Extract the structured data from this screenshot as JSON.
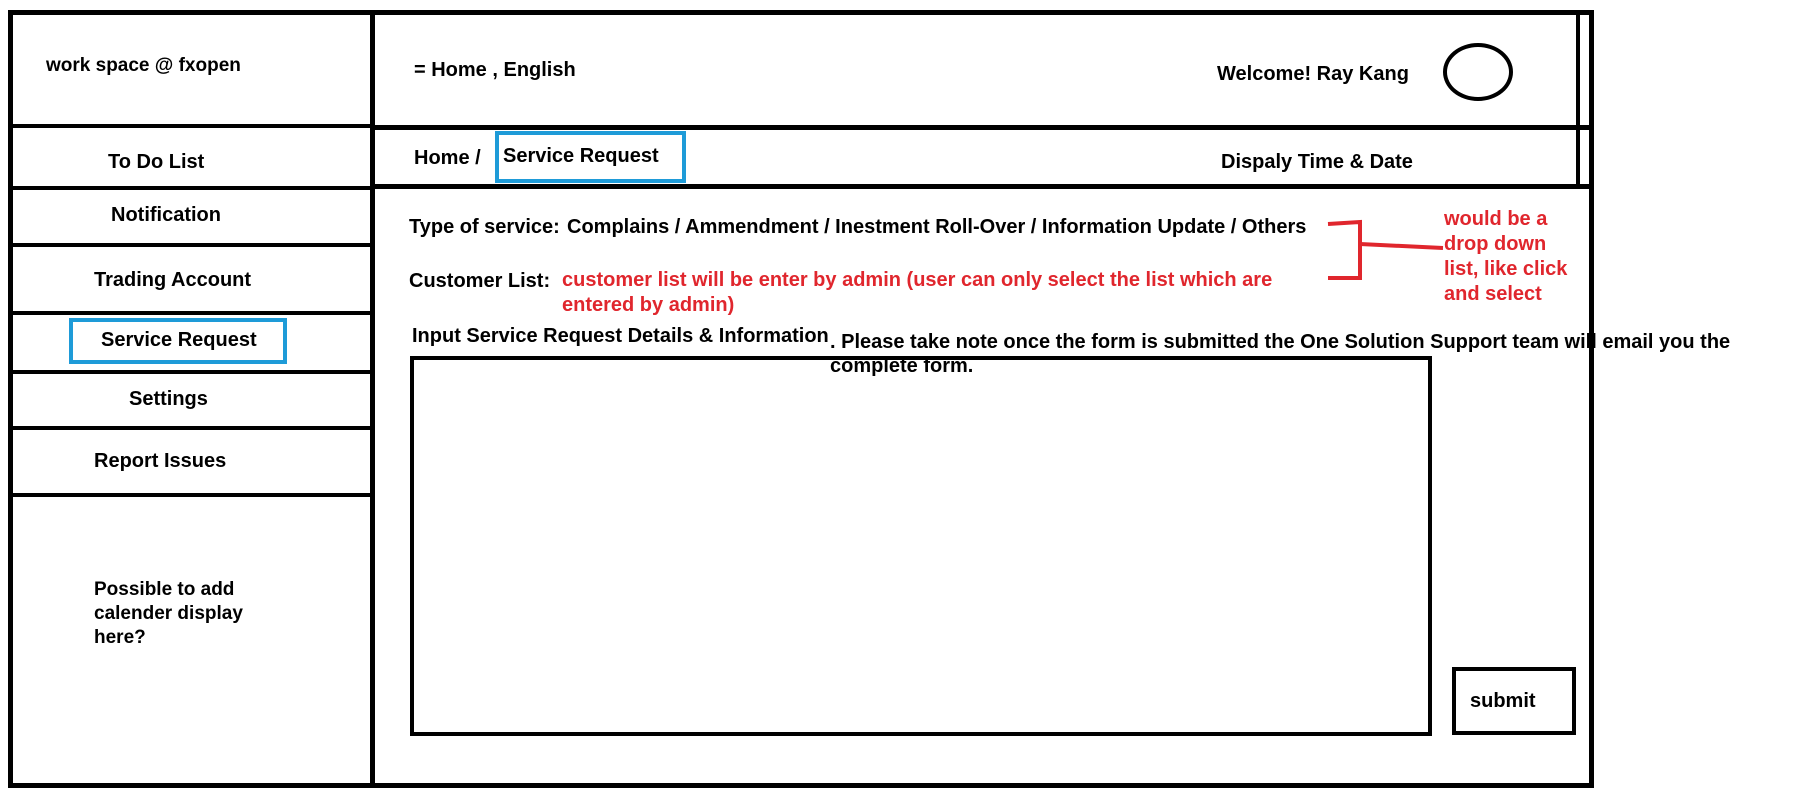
{
  "header": {
    "brand": "work space @ fxopen",
    "nav": "= Home , English",
    "welcome": "Welcome! Ray Kang"
  },
  "sidebar": {
    "items": [
      {
        "label": "To Do List"
      },
      {
        "label": "Notification"
      },
      {
        "label": "Trading Account"
      },
      {
        "label": "Service Request"
      },
      {
        "label": "Settings"
      },
      {
        "label": "Report Issues"
      }
    ],
    "calendar_note": "Possible to add calender display here?"
  },
  "breadcrumb": {
    "home": "Home /",
    "current": "Service Request",
    "datetime": "Dispaly Time & Date"
  },
  "form": {
    "service_type_label": "Type of service:",
    "service_type_options": "Complains / Ammendment / Inestment Roll-Over / Information Update / Others",
    "customer_list_label": "Customer List:",
    "customer_list_note": "customer list will be enter by admin (user can only select the list which are entered by admin)",
    "details_label": "Input Service Request Details & Information",
    "submit_note": ". Please take note once the form is submitted the One Solution Support team will email you the complete form.",
    "details_value": "",
    "submit_label": "submit"
  },
  "annotation": {
    "dropdown_note": "would be a drop down list, like click and select"
  },
  "colors": {
    "annotation": "#e0262d",
    "highlight": "#1e9bd8"
  }
}
